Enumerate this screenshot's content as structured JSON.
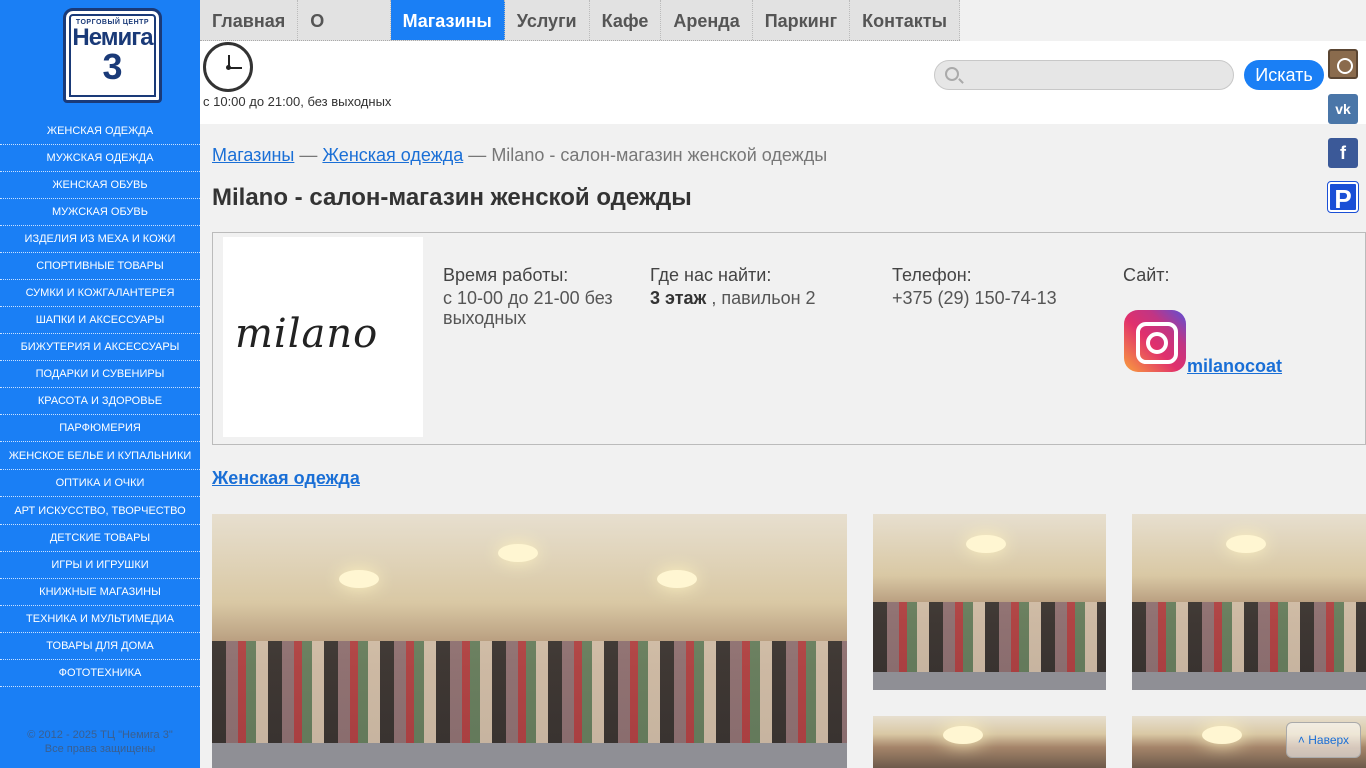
{
  "logo": {
    "small": "ТОРГОВЫЙ ЦЕНТР",
    "name": "Немига",
    "number": "3"
  },
  "sidebar": {
    "items": [
      "ЖЕНСКАЯ ОДЕЖДА",
      "МУЖСКАЯ ОДЕЖДА",
      "ЖЕНСКАЯ ОБУВЬ",
      "МУЖСКАЯ ОБУВЬ",
      "ИЗДЕЛИЯ ИЗ МЕХА И КОЖИ",
      "СПОРТИВНЫЕ ТОВАРЫ",
      "СУМКИ И КОЖГАЛАНТЕРЕЯ",
      "ШАПКИ И АКСЕССУАРЫ",
      "БИЖУТЕРИЯ И АКСЕССУАРЫ",
      "ПОДАРКИ И СУВЕНИРЫ",
      "КРАСОТА И ЗДОРОВЬЕ",
      "ПАРФЮМЕРИЯ",
      "ЖЕНСКОЕ БЕЛЬЕ И КУПАЛЬНИКИ",
      "ОПТИКА И ОЧКИ",
      "АРТ ИСКУССТВО, ТВОРЧЕСТВО",
      "ДЕТСКИЕ ТОВАРЫ",
      "ИГРЫ И ИГРУШКИ",
      "КНИЖНЫЕ МАГАЗИНЫ",
      "ТЕХНИКА И МУЛЬТИМЕДИА",
      "ТОВАРЫ ДЛЯ ДОМА",
      "ФОТОТЕХНИКА"
    ],
    "copyright_1": "© 2012 - 2025 ТЦ \"Немига 3\"",
    "copyright_2": "Все права защищены"
  },
  "nav": {
    "items": [
      "Главная",
      "О центре",
      "Магазины",
      "Услуги",
      "Кафе",
      "Аренда",
      "Паркинг",
      "Контакты"
    ],
    "active": "Магазины"
  },
  "header": {
    "hours": "с 10:00 до 21:00, без выходных",
    "search_placeholder": "",
    "search_button": "Искать"
  },
  "social": {
    "vk": "vk",
    "fb": "f",
    "parking": "P"
  },
  "breadcrumb": {
    "root": "Магазины",
    "category": "Женская одежда",
    "separator": "—",
    "current": "Milano - салон-магазин женской одежды"
  },
  "store": {
    "title": "Milano - салон-магазин женской одежды",
    "logo_text": "milano",
    "hours_label": "Время работы:",
    "hours_value": "с 10-00 до 21-00 без выходных",
    "location_label": "Где нас найти:",
    "location_floor": "3 этаж",
    "location_rest": " , павильон 2",
    "phone_label": "Телефон:",
    "phone_value": "+375 (29) 150-74-13",
    "site_label": "Сайт:",
    "instagram_handle": "milanocoat"
  },
  "category_link": "Женская одежда",
  "to_top": "˄ Наверх"
}
